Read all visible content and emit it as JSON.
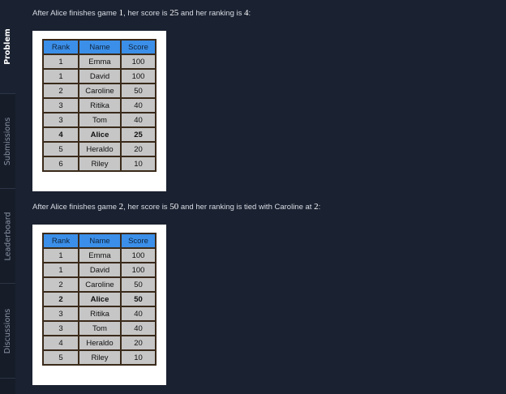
{
  "rail": {
    "tabs": [
      {
        "label": "Problem",
        "active": true
      },
      {
        "label": "Submissions",
        "active": false
      },
      {
        "label": "Leaderboard",
        "active": false
      },
      {
        "label": "Discussions",
        "active": false
      }
    ]
  },
  "paragraphs": [
    {
      "prefix": "After Alice finishes game ",
      "game": "1",
      "mid1": ", her score is ",
      "score": "25",
      "mid2": " and her ranking is ",
      "rank": "4",
      "suffix": ":"
    },
    {
      "prefix": "After Alice finishes game ",
      "game": "2",
      "mid1": ", her score is ",
      "score": "50",
      "mid2": " and her ranking is tied with Caroline at ",
      "rank": "2",
      "suffix": ":"
    }
  ],
  "tables": [
    {
      "headers": [
        "Rank",
        "Name",
        "Score"
      ],
      "highlight_row": 5,
      "rows": [
        [
          "1",
          "Emma",
          "100"
        ],
        [
          "1",
          "David",
          "100"
        ],
        [
          "2",
          "Caroline",
          "50"
        ],
        [
          "3",
          "Ritika",
          "40"
        ],
        [
          "3",
          "Tom",
          "40"
        ],
        [
          "4",
          "Alice",
          "25"
        ],
        [
          "5",
          "Heraldo",
          "20"
        ],
        [
          "6",
          "Riley",
          "10"
        ]
      ]
    },
    {
      "headers": [
        "Rank",
        "Name",
        "Score"
      ],
      "highlight_row": 3,
      "rows": [
        [
          "1",
          "Emma",
          "100"
        ],
        [
          "1",
          "David",
          "100"
        ],
        [
          "2",
          "Caroline",
          "50"
        ],
        [
          "2",
          "Alice",
          "50"
        ],
        [
          "3",
          "Ritika",
          "40"
        ],
        [
          "3",
          "Tom",
          "40"
        ],
        [
          "4",
          "Heraldo",
          "20"
        ],
        [
          "5",
          "Riley",
          "10"
        ]
      ]
    }
  ],
  "colors": {
    "background": "#1a2130",
    "header_blue": "#3b8fe8",
    "cell_gray": "#c6c6c6",
    "border_brown": "#3a2a1a"
  }
}
